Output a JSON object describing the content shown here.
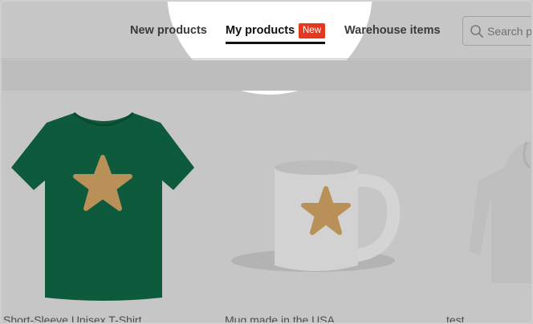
{
  "nav": {
    "items": [
      {
        "label": "New products"
      },
      {
        "label": "My products",
        "badge": "New",
        "active": true
      },
      {
        "label": "Warehouse items"
      }
    ]
  },
  "search": {
    "placeholder": "Search p",
    "icon": "search-icon"
  },
  "products": [
    {
      "title": "Short-Sleeve Unisex T-Shirt",
      "image": "green-tshirt-with-star",
      "color": "#0d5a3c"
    },
    {
      "title": "Mug made in the USA",
      "image": "white-mug-with-star",
      "color": "#d0d0d0"
    },
    {
      "title": "test",
      "image": "white-hoodie",
      "color": "#bdbdbd"
    }
  ],
  "colors": {
    "accent": "#e8371f",
    "star": "#b99158",
    "overlay": "#c6c6c6"
  }
}
